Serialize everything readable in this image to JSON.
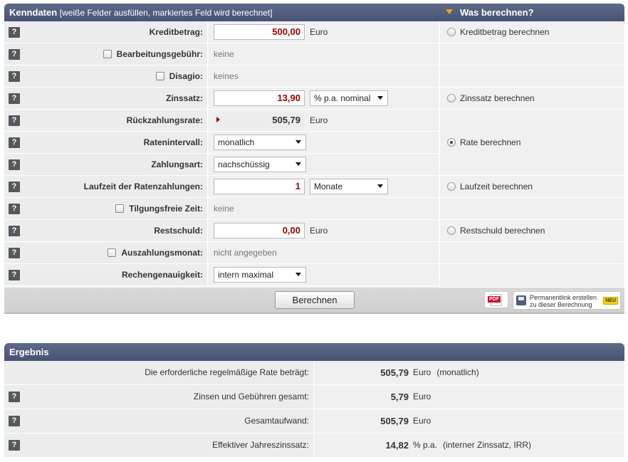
{
  "kenndaten": {
    "title": "Kenndaten",
    "subtitle": "[weiße Felder ausfüllen, markiertes Feld wird berechnet]",
    "was_berechnen": "Was berechnen?",
    "help_glyph": "?",
    "rows": {
      "kreditbetrag": {
        "label": "Kreditbetrag:",
        "value": "500,00",
        "unit": "Euro"
      },
      "bearbeitungsgebuehr": {
        "label": "Bearbeitungsgebühr:",
        "value": "keine",
        "checked": false
      },
      "disagio": {
        "label": "Disagio:",
        "value": "keines",
        "checked": false
      },
      "zinssatz": {
        "label": "Zinssatz:",
        "value": "13,90",
        "select": "% p.a. nominal"
      },
      "rueckzahlungsrate": {
        "label": "Rückzahlungsrate:",
        "value": "505,79",
        "unit": "Euro",
        "is_computed": true
      },
      "ratenintervall": {
        "label": "Ratenintervall:",
        "select": "monatlich"
      },
      "zahlungsart": {
        "label": "Zahlungsart:",
        "select": "nachschüssig"
      },
      "laufzeit": {
        "label": "Laufzeit der Ratenzahlungen:",
        "value": "1",
        "select": "Monate"
      },
      "tilgungsfreie_zeit": {
        "label": "Tilgungsfreie Zeit:",
        "value": "keine",
        "checked": false
      },
      "restschuld": {
        "label": "Restschuld:",
        "value": "0,00",
        "unit": "Euro"
      },
      "auszahlungsmonat": {
        "label": "Auszahlungsmonat:",
        "value": "nicht angegeben",
        "checked": false
      },
      "rechengenauigkeit": {
        "label": "Rechengenauigkeit:",
        "select": "intern maximal"
      }
    },
    "radios": {
      "kreditbetrag": {
        "label": "Kreditbetrag berechnen",
        "selected": false
      },
      "zinssatz": {
        "label": "Zinssatz berechnen",
        "selected": false
      },
      "rate": {
        "label": "Rate berechnen",
        "selected": true
      },
      "laufzeit": {
        "label": "Laufzeit berechnen",
        "selected": false
      },
      "restschuld": {
        "label": "Restschuld berechnen",
        "selected": false
      }
    },
    "footer": {
      "button": "Berechnen",
      "pdf_tag": "PDF",
      "permalink_line1": "Permanentlink erstellen",
      "permalink_line2": "zu dieser Berechnung",
      "neu_badge": "NEU"
    }
  },
  "ergebnis": {
    "title": "Ergebnis",
    "rows": [
      {
        "label": "Die erforderliche regelmäßige Rate beträgt:",
        "value": "505,79",
        "unit": "Euro",
        "note": "(monatlich)",
        "help": false
      },
      {
        "label": "Zinsen und Gebühren gesamt:",
        "value": "5,79",
        "unit": "Euro",
        "note": "",
        "help": true
      },
      {
        "label": "Gesamtaufwand:",
        "value": "505,79",
        "unit": "Euro",
        "note": "",
        "help": true
      },
      {
        "label": "Effektiver Jahreszinssatz:",
        "value": "14,82",
        "unit": "% p.a.",
        "note": "(interner Zinssatz, IRR)",
        "help": true
      }
    ]
  },
  "colors": {
    "header_bg": "#4e5b7c",
    "accent_triangle": "#f5a400",
    "input_value": "#a00000"
  },
  "icons": [
    "help-icon",
    "checkbox-icon",
    "radio-icon",
    "dropdown-arrow-icon",
    "pdf-icon",
    "save-disk-icon"
  ]
}
